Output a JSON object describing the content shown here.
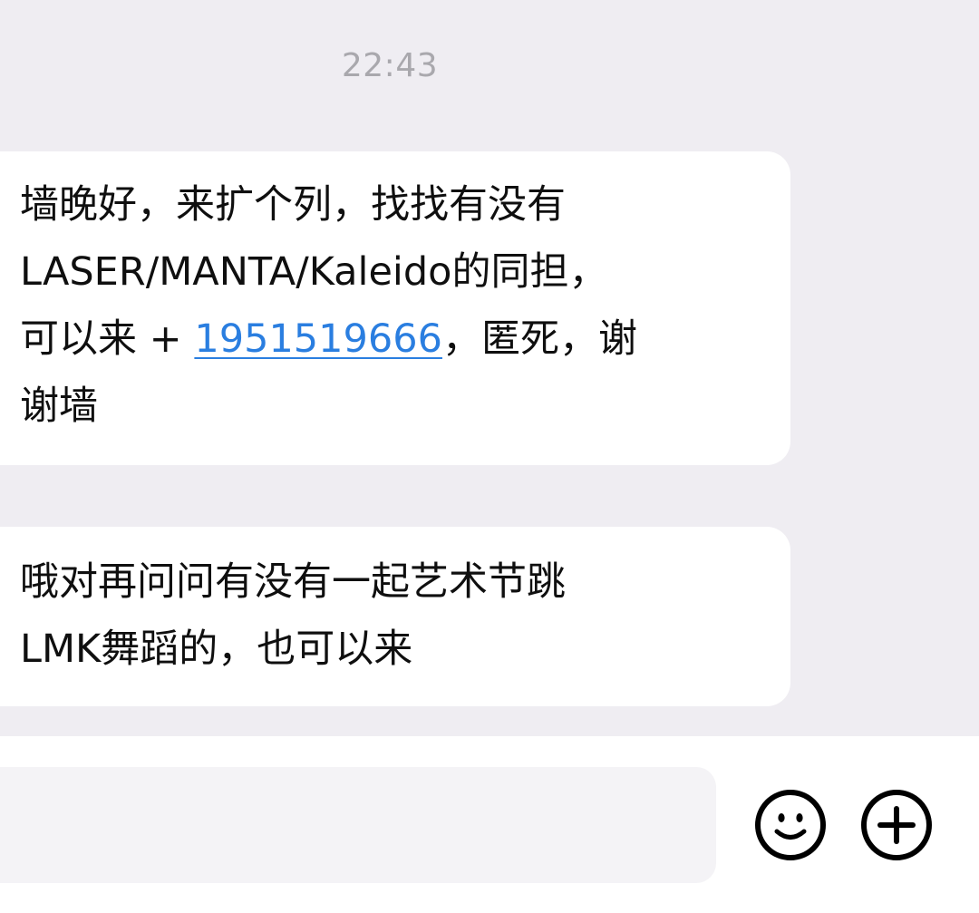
{
  "chat": {
    "timestamp": "22:43",
    "messages": [
      {
        "lines": [
          "墙晚好，来扩个列，找找有没有",
          "LASER/MANTA/Kaleido的同担，"
        ],
        "line3_prefix": "可以来 + ",
        "phone": "1951519666",
        "line3_suffix": "，匿死，谢",
        "line4": "谢墙"
      },
      {
        "lines": [
          "哦对再问问有没有一起艺术节跳",
          "LMK舞蹈的，也可以来"
        ]
      }
    ]
  },
  "input_bar": {
    "value": "",
    "placeholder": ""
  },
  "icons": {
    "emoji": "smiley-face-icon",
    "more": "plus-circle-icon"
  },
  "colors": {
    "background": "#efedf2",
    "bubble": "#ffffff",
    "link": "#2a7ee0",
    "timestamp": "#a9a8ad"
  }
}
